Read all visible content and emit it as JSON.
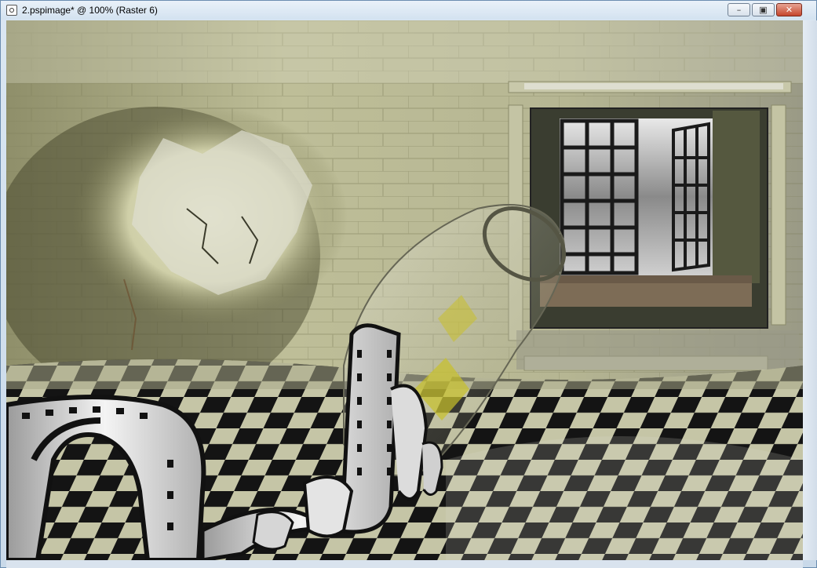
{
  "window": {
    "title": "2.pspimage* @ 100% (Raster 6)",
    "minimize_icon": "minimize-icon",
    "maximize_icon": "restore-icon",
    "close_icon": "close-icon"
  },
  "canvas": {
    "layer": "Raster 6",
    "zoom": "100%",
    "colors": {
      "wall": "#b8b890",
      "floor_light": "#c9c9aa",
      "floor_dark": "#151515",
      "accent_yellow": "#c8c02a"
    }
  }
}
